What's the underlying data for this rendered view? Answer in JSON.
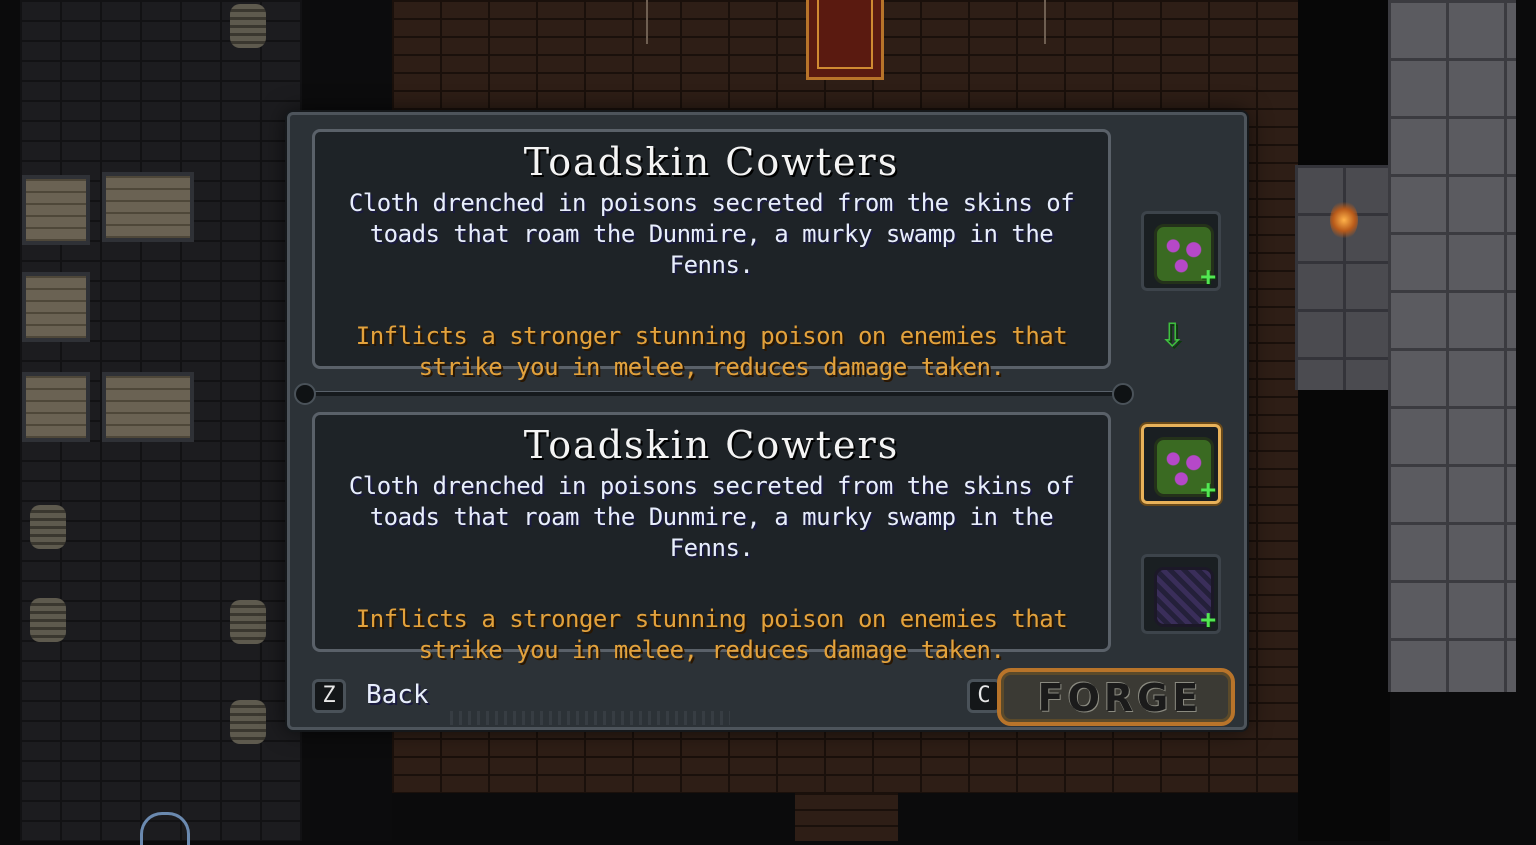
{
  "panel": {
    "current_item": {
      "name": "Toadskin Cowters",
      "description": "Cloth drenched in poisons secreted from the skins of toads that roam the Dunmire, a murky swamp in the Fenns.",
      "effect": "Inflicts a stronger stunning poison on enemies that strike you in melee, reduces damage taken."
    },
    "new_item": {
      "name": "Toadskin Cowters",
      "description": "Cloth drenched in poisons secreted from the skins of toads that roam the Dunmire, a murky swamp in the Fenns.",
      "effect": "Inflicts a stronger stunning poison on enemies that strike you in melee, reduces damage taken."
    },
    "slots": [
      {
        "icon": "toadskin-cowters-icon",
        "badge": "+",
        "selected": false
      },
      {
        "icon": "toadskin-cowters-icon",
        "badge": "+",
        "selected": true
      },
      {
        "icon": "dark-cloth-icon",
        "badge": "+",
        "selected": false
      }
    ],
    "arrow_icon": "down-arrow-icon",
    "back": {
      "key": "Z",
      "label": "Back"
    },
    "forge": {
      "key": "C",
      "label": "FORGE"
    }
  },
  "colors": {
    "panel_bg": "#2c3237",
    "title_text": "#f4f4f4",
    "description_text": "#e8eefc",
    "effect_text": "#e3a23c",
    "selected_border": "#e8b25a",
    "plus_badge": "#52e852"
  }
}
